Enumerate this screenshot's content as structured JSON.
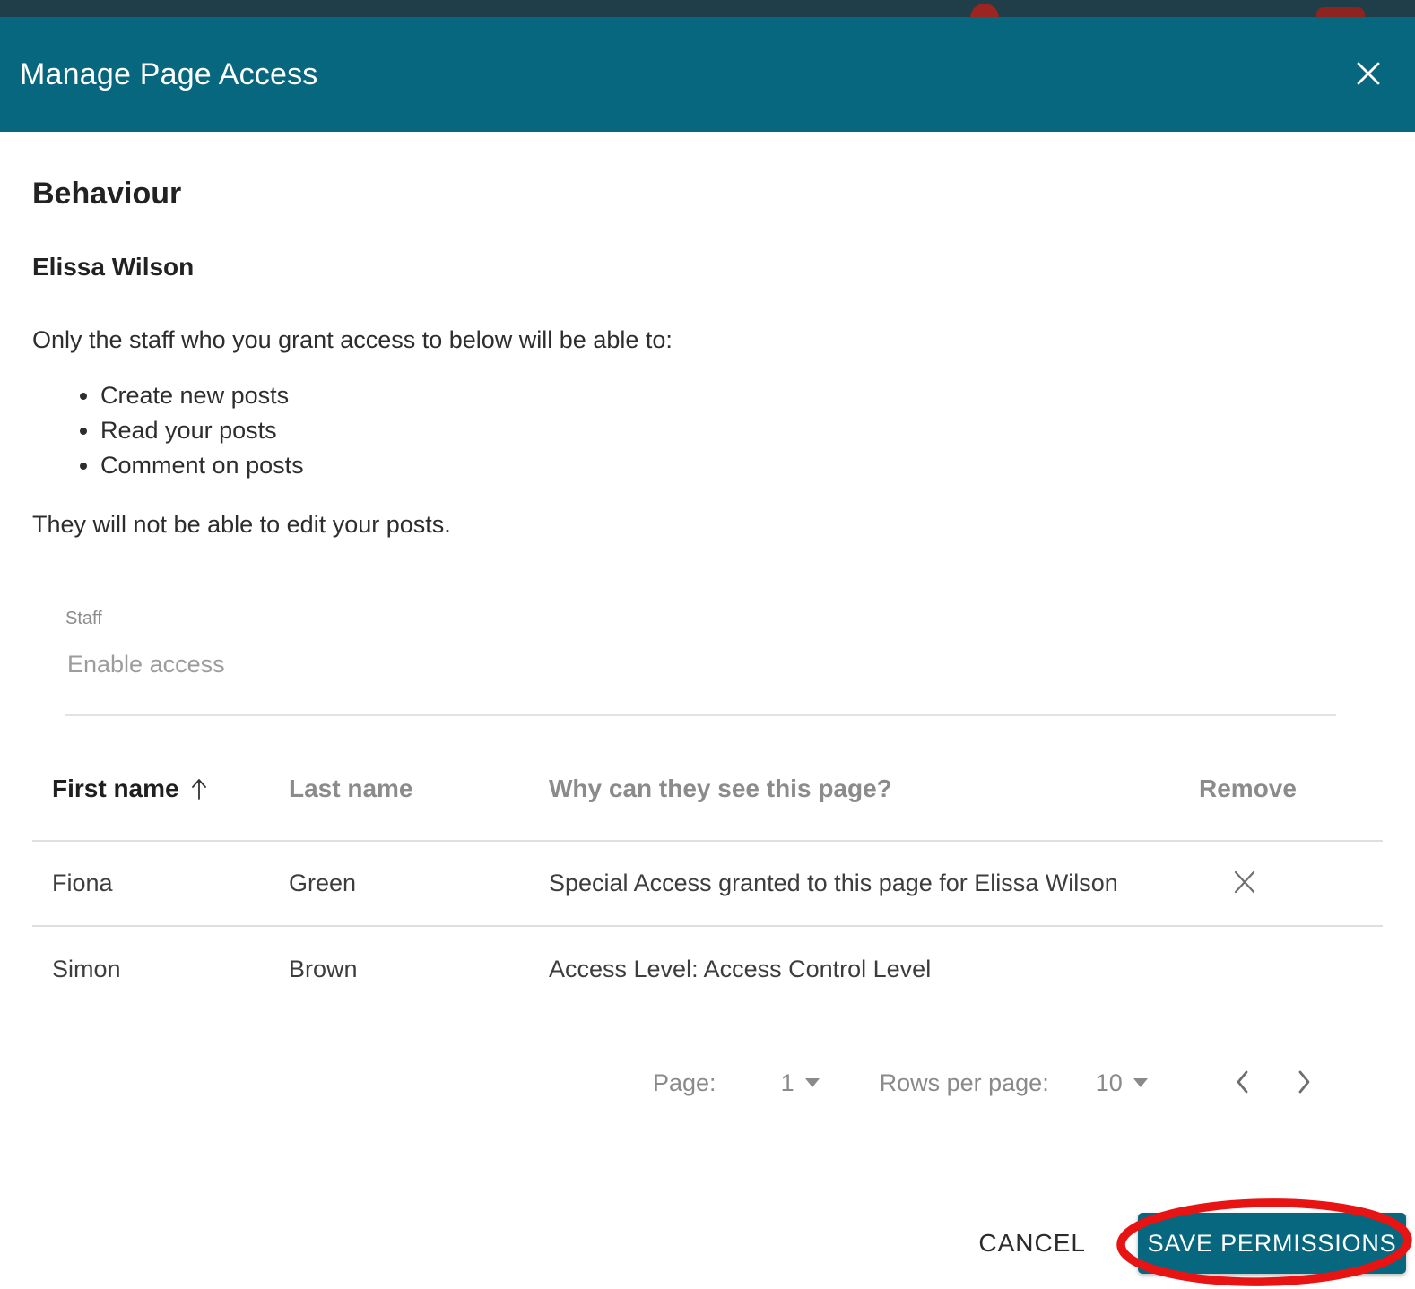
{
  "colors": {
    "teal": "#06677e",
    "top_bar": "#1f3e49",
    "badge_red": "#9b2520",
    "annotation_red": "#e81414"
  },
  "modal": {
    "title": "Manage Page Access",
    "heading": "Behaviour",
    "subheading": "Elissa Wilson",
    "intro": "Only the staff who you grant access to below will be able to:",
    "bullets": [
      "Create new posts",
      "Read your posts",
      "Comment on posts"
    ],
    "note": "They will not be able to edit your posts.",
    "staff_field": {
      "label": "Staff",
      "placeholder": "Enable access"
    },
    "table": {
      "columns": [
        {
          "label": "First name",
          "sort": "asc"
        },
        {
          "label": "Last name",
          "sort": ""
        },
        {
          "label": "Why can they see this page?",
          "sort": ""
        },
        {
          "label": "Remove",
          "sort": ""
        }
      ],
      "rows": [
        {
          "first_name": "Fiona",
          "last_name": "Green",
          "reason": "Special Access granted to this page for Elissa Wilson",
          "removable": true
        },
        {
          "first_name": "Simon",
          "last_name": "Brown",
          "reason": "Access Level: Access Control Level",
          "removable": false
        }
      ]
    },
    "pagination": {
      "page_label": "Page:",
      "page_value": "1",
      "rows_per_page_label": "Rows per page:",
      "rows_per_page_value": "10"
    },
    "actions": {
      "cancel_label": "CANCEL",
      "save_label": "SAVE PERMISSIONS"
    }
  },
  "icons": {
    "close": "✕",
    "sort_ascending": "↑",
    "remove_row": "✕",
    "dropdown_caret": "▾",
    "prev_page": "‹",
    "next_page": "›"
  }
}
